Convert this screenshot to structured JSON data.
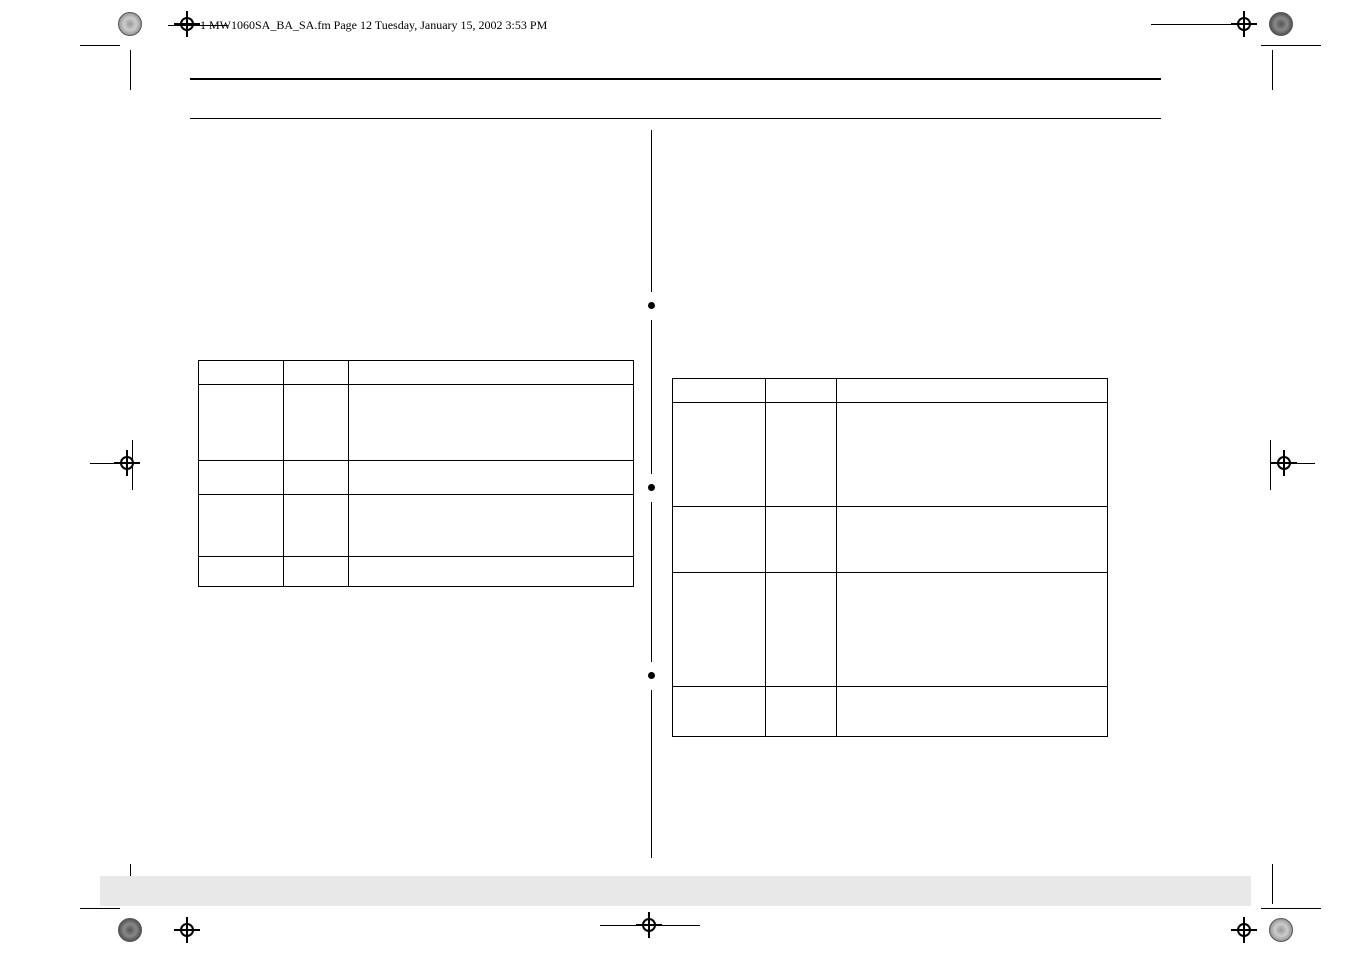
{
  "header": {
    "crop_info": "1 MW1060SA_BA_SA.fm  Page 12  Tuesday, January 15, 2002  3:53 PM"
  },
  "tables": {
    "left": {
      "rows": [
        {
          "c1": "",
          "c2": "",
          "c3": ""
        },
        {
          "c1": "",
          "c2": "",
          "c3": ""
        },
        {
          "c1": "",
          "c2": "",
          "c3": ""
        },
        {
          "c1": "",
          "c2": "",
          "c3": ""
        },
        {
          "c1": "",
          "c2": "",
          "c3": ""
        }
      ]
    },
    "right": {
      "rows": [
        {
          "c1": "",
          "c2": "",
          "c3": ""
        },
        {
          "c1": "",
          "c2": "",
          "c3": ""
        },
        {
          "c1": "",
          "c2": "",
          "c3": ""
        },
        {
          "c1": "",
          "c2": "",
          "c3": ""
        },
        {
          "c1": "",
          "c2": "",
          "c3": ""
        }
      ]
    }
  },
  "marks": {
    "top_left_circle": "registration-circle",
    "target": "registration-target"
  }
}
